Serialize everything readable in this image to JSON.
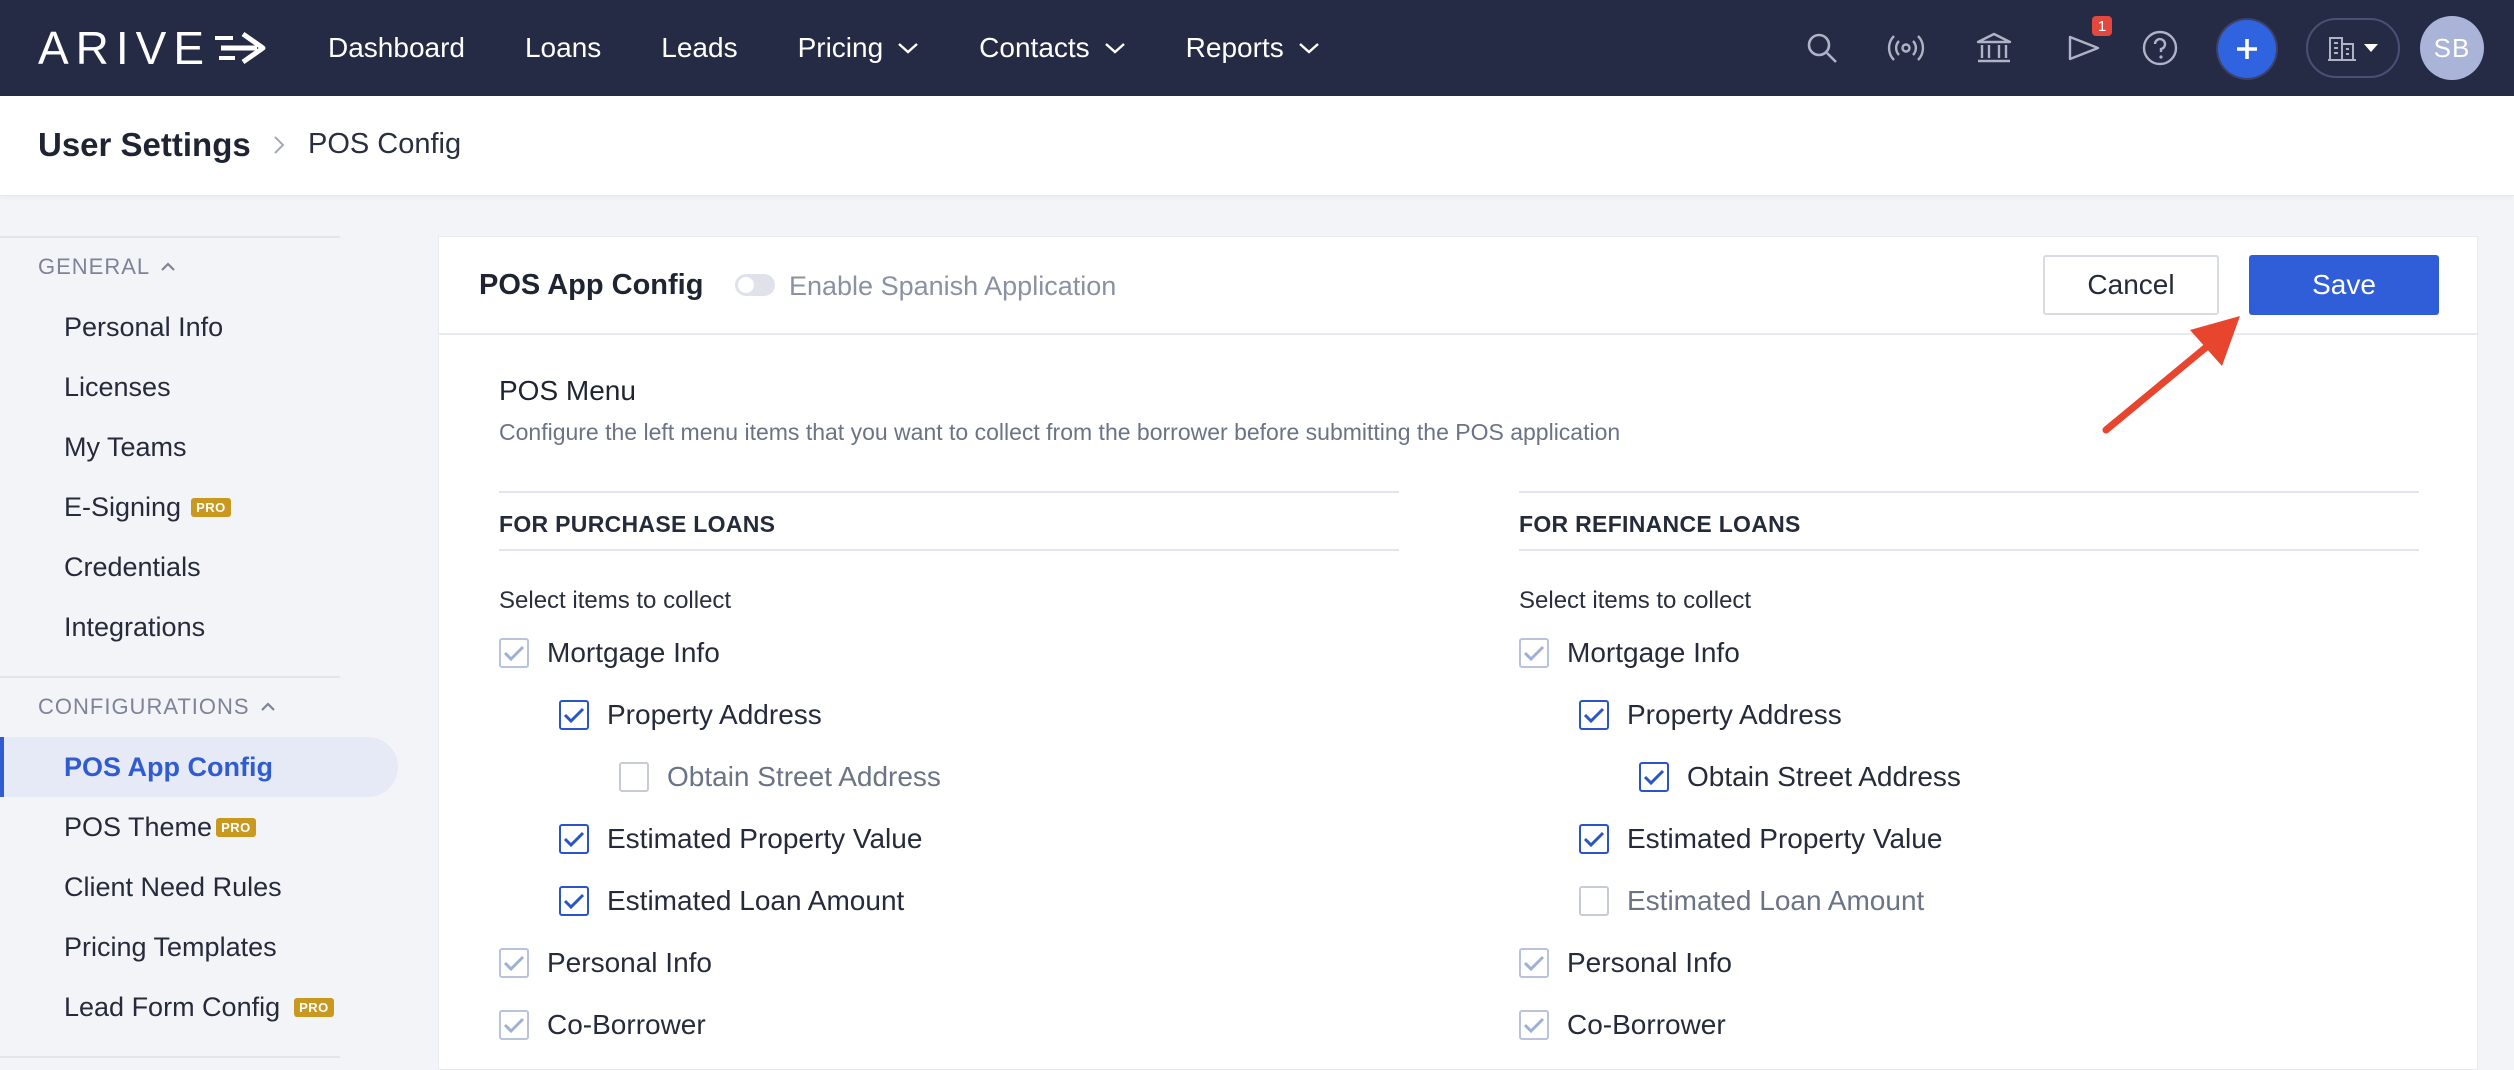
{
  "nav": {
    "logo_text": "ARIVE",
    "links": [
      {
        "label": "Dashboard",
        "has_menu": false
      },
      {
        "label": "Loans",
        "has_menu": false
      },
      {
        "label": "Leads",
        "has_menu": false
      },
      {
        "label": "Pricing",
        "has_menu": true
      },
      {
        "label": "Contacts",
        "has_menu": true
      },
      {
        "label": "Reports",
        "has_menu": true
      }
    ],
    "notification_count": "1",
    "avatar_initials": "SB",
    "icons": [
      "search-icon",
      "broadcast-icon",
      "bank-icon",
      "announcement-icon",
      "help-icon",
      "plus-icon",
      "building-icon",
      "caret-down-icon"
    ]
  },
  "breadcrumb": {
    "root": "User Settings",
    "current": "POS Config"
  },
  "sidebar": {
    "general_header": "GENERAL",
    "general_items": [
      {
        "label": "Personal Info",
        "pro": false
      },
      {
        "label": "Licenses",
        "pro": false
      },
      {
        "label": "My Teams",
        "pro": false
      },
      {
        "label": "E-Signing",
        "pro": true
      },
      {
        "label": "Credentials",
        "pro": false
      },
      {
        "label": "Integrations",
        "pro": false
      }
    ],
    "config_header": "CONFIGURATIONS",
    "config_items": [
      {
        "label": "POS App Config",
        "pro": false,
        "active": true
      },
      {
        "label": "POS Theme",
        "pro": true,
        "active": false
      },
      {
        "label": "Client Need Rules",
        "pro": false,
        "active": false
      },
      {
        "label": "Pricing Templates",
        "pro": false,
        "active": false
      },
      {
        "label": "Lead Form Config",
        "pro": true,
        "active": false
      }
    ],
    "pro_badge": "PRO"
  },
  "card": {
    "title": "POS App Config",
    "toggle_label": "Enable Spanish Application",
    "toggle_on": false,
    "cancel_label": "Cancel",
    "save_label": "Save",
    "menu_title": "POS Menu",
    "menu_desc": "Configure the left menu items that you want to collect from the borrower before submitting the POS application"
  },
  "purchase": {
    "heading": "FOR PURCHASE LOANS",
    "subheading": "Select items to collect",
    "items": [
      {
        "label": "Mortgage Info",
        "level": 0,
        "checked": true,
        "locked": true
      },
      {
        "label": "Property Address",
        "level": 1,
        "checked": true,
        "locked": false
      },
      {
        "label": "Obtain Street Address",
        "level": 2,
        "checked": false,
        "locked": false
      },
      {
        "label": "Estimated Property Value",
        "level": 1,
        "checked": true,
        "locked": false
      },
      {
        "label": "Estimated Loan Amount",
        "level": 1,
        "checked": true,
        "locked": false
      },
      {
        "label": "Personal Info",
        "level": 0,
        "checked": true,
        "locked": true
      },
      {
        "label": "Co-Borrower",
        "level": 0,
        "checked": true,
        "locked": true
      }
    ]
  },
  "refinance": {
    "heading": "FOR REFINANCE LOANS",
    "subheading": "Select items to collect",
    "items": [
      {
        "label": "Mortgage Info",
        "level": 0,
        "checked": true,
        "locked": true
      },
      {
        "label": "Property Address",
        "level": 1,
        "checked": true,
        "locked": false
      },
      {
        "label": "Obtain Street Address",
        "level": 2,
        "checked": true,
        "locked": false
      },
      {
        "label": "Estimated Property Value",
        "level": 1,
        "checked": true,
        "locked": false
      },
      {
        "label": "Estimated Loan Amount",
        "level": 1,
        "checked": false,
        "locked": false
      },
      {
        "label": "Personal Info",
        "level": 0,
        "checked": true,
        "locked": true
      },
      {
        "label": "Co-Borrower",
        "level": 0,
        "checked": true,
        "locked": true
      }
    ]
  },
  "colors": {
    "nav_bg": "#262b45",
    "primary": "#2f5ed8",
    "annotation_arrow": "#e8452e",
    "pro_badge": "#c9991f"
  }
}
